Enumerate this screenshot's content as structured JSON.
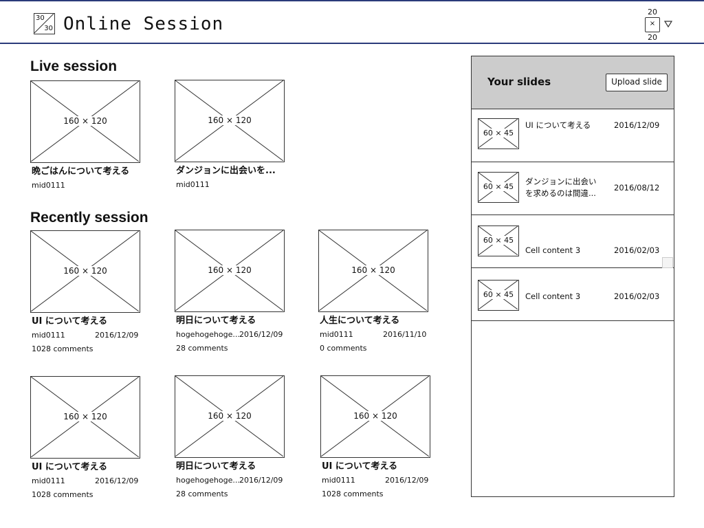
{
  "header": {
    "logo_text_top": "30",
    "logo_text_bottom": "30",
    "title": "Online Session",
    "avatar_top_label": "20",
    "avatar_label": "×",
    "avatar_bottom_label": "20",
    "menu_caret_icon": "caret-down-icon"
  },
  "live": {
    "title": "Live session",
    "cards": [
      {
        "thumb_label": "160 × 120",
        "title": "晩ごはんについて考える",
        "user": "mid0111"
      },
      {
        "thumb_label": "160 × 120",
        "title": "ダンジョンに出会いを...",
        "user": "mid0111"
      }
    ]
  },
  "recent": {
    "title": "Recently session",
    "cards": [
      {
        "thumb_label": "160 × 120",
        "title": "UI について考える",
        "user": "mid0111",
        "date": "2016/12/09",
        "comments": "1028 comments"
      },
      {
        "thumb_label": "160 × 120",
        "title": "明日について考える",
        "user": "hogehogehoge...",
        "date": "2016/12/09",
        "comments": "28 comments"
      },
      {
        "thumb_label": "160 × 120",
        "title": "人生について考える",
        "user": "mid0111",
        "date": "2016/11/10",
        "comments": "0 comments"
      },
      {
        "thumb_label": "160 × 120",
        "title": "UI について考える",
        "user": "mid0111",
        "date": "2016/12/09",
        "comments": "1028 comments"
      },
      {
        "thumb_label": "160 × 120",
        "title": "明日について考える",
        "user": "hogehogehoge...",
        "date": "2016/12/09",
        "comments": "28 comments"
      },
      {
        "thumb_label": "160 × 120",
        "title": "UI について考える",
        "user": "mid0111",
        "date": "2016/12/09",
        "comments": "1028 comments"
      }
    ]
  },
  "sidebar": {
    "title": "Your slides",
    "upload_label": "Upload slide",
    "slides": [
      {
        "thumb_label": "60 × 45",
        "name": "UI について考える",
        "date": "2016/12/09"
      },
      {
        "thumb_label": "60 × 45",
        "name": "ダンジョンに出会いを求めるのは間違...",
        "date": "2016/08/12"
      },
      {
        "thumb_label": "60 × 45",
        "name": "Cell content 3",
        "date": "2016/02/03"
      },
      {
        "thumb_label": "60 × 45",
        "name": "Cell content 3",
        "date": "2016/02/03"
      }
    ]
  }
}
